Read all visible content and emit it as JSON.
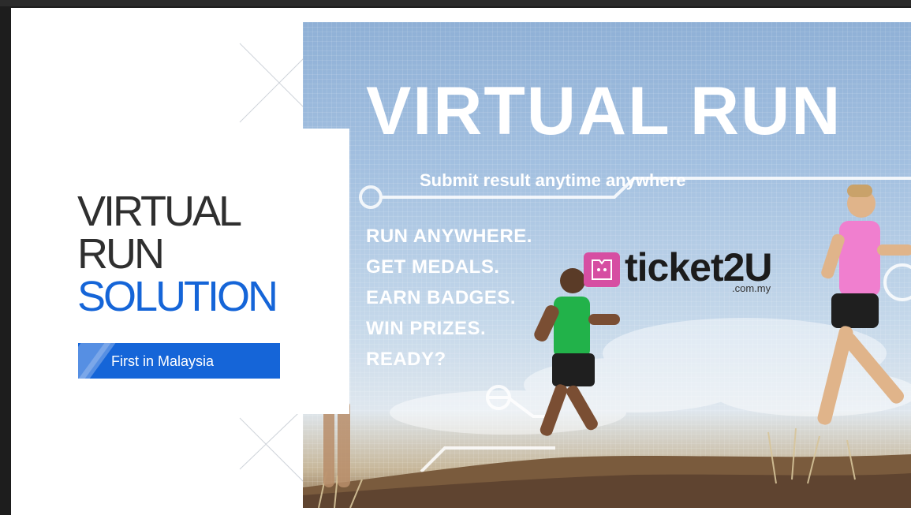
{
  "slide": {
    "heading": {
      "line1": "VIRTUAL",
      "line2": "RUN",
      "line3": "SOLUTION"
    },
    "badge_label": "First in Malaysia"
  },
  "banner": {
    "title": "VIRTUAL RUN",
    "subtitle": "Submit result anytime anywhere",
    "lines": [
      "RUN ANYWHERE.",
      "GET MEDALS.",
      "EARN BADGES.",
      "WIN PRIZES.",
      "READY?"
    ],
    "brand": {
      "name": "ticket2U",
      "domain": ".com.my",
      "color": "#d64ea2"
    },
    "scene": "two runners on a hilltop trail under a blue sky"
  },
  "colors": {
    "accent": "#1565d8",
    "heading_text": "#2f2f2f",
    "frame": "#1d1d1d"
  }
}
